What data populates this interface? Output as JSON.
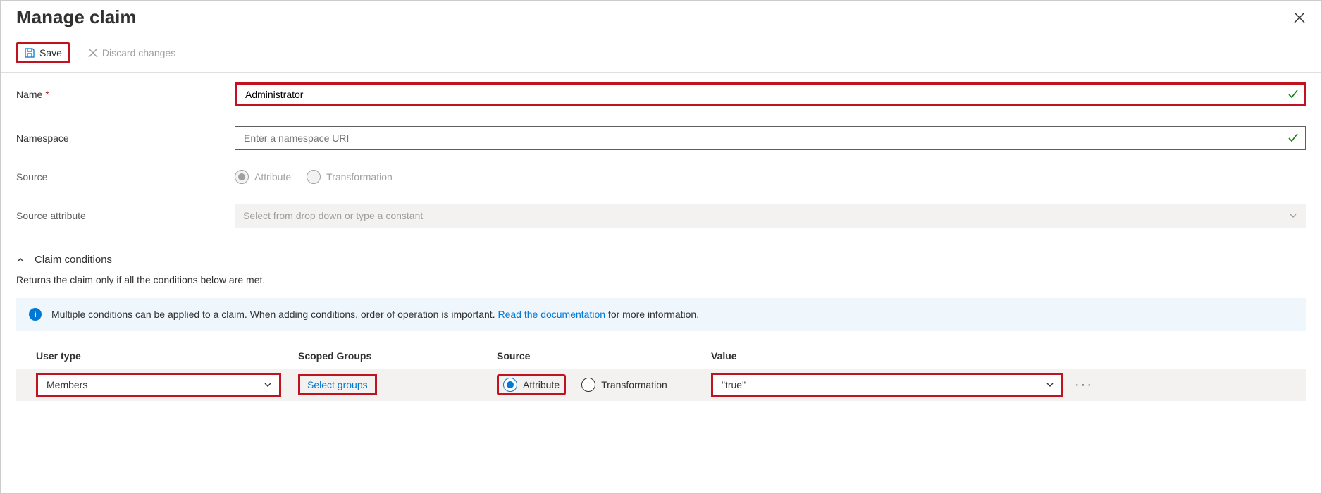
{
  "header": {
    "title": "Manage claim"
  },
  "toolbar": {
    "save_label": "Save",
    "discard_label": "Discard changes"
  },
  "form": {
    "name_label": "Name",
    "name_value": "Administrator",
    "namespace_label": "Namespace",
    "namespace_placeholder": "Enter a namespace URI",
    "namespace_value": "",
    "source_label": "Source",
    "source_options": {
      "attribute": "Attribute",
      "transformation": "Transformation"
    },
    "source_attribute_label": "Source attribute",
    "source_attribute_placeholder": "Select from drop down or type a constant"
  },
  "conditions": {
    "section_title": "Claim conditions",
    "description": "Returns the claim only if all the conditions below are met.",
    "info_prefix": "Multiple conditions can be applied to a claim.  When adding conditions, order of operation is important. ",
    "info_link": "Read the documentation",
    "info_suffix": " for more information.",
    "columns": {
      "user_type": "User type",
      "scoped_groups": "Scoped Groups",
      "source": "Source",
      "value": "Value"
    },
    "rows": [
      {
        "user_type": "Members",
        "scoped_groups_link": "Select groups",
        "source_attribute": "Attribute",
        "source_transformation": "Transformation",
        "source_selected": "attribute",
        "value": "\"true\""
      }
    ]
  }
}
